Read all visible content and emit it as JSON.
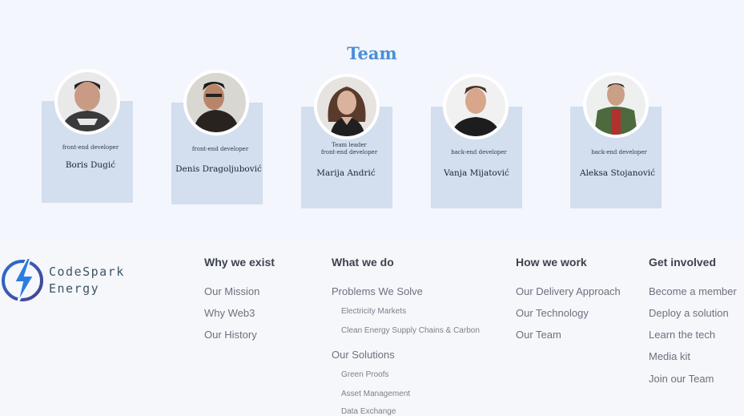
{
  "team": {
    "title": "Team",
    "members": [
      {
        "role": "front-end developer",
        "name": "Boris Dugić"
      },
      {
        "role": "front-end developer",
        "name": "Denis Dragoljubović"
      },
      {
        "role_line1": "Team leader",
        "role_line2": "front-end developer",
        "name": "Marija Andrić"
      },
      {
        "role": "back-end developer",
        "name": "Vanja Mijatović"
      },
      {
        "role": "back-end developer",
        "name": "Aleksa Stojanović"
      }
    ]
  },
  "footer": {
    "brand": {
      "line1": "CodeSpark",
      "line2": "Energy"
    },
    "columns": [
      {
        "heading": "Why we exist",
        "links": [
          "Our Mission",
          "Why Web3",
          "Our History"
        ]
      },
      {
        "heading": "What we do",
        "group1": "Problems We Solve",
        "group1_items": [
          "Electricity Markets",
          "Clean Energy Supply Chains & Carbon"
        ],
        "group2": "Our Solutions",
        "group2_items": [
          "Green Proofs",
          "Asset Management",
          "Data Exchange"
        ]
      },
      {
        "heading": "How we work",
        "links": [
          "Our Delivery Approach",
          "Our Technology",
          "Our Team"
        ]
      },
      {
        "heading": "Get involved",
        "links": [
          "Become a member",
          "Deploy a solution",
          "Learn the tech",
          "Media kit",
          "Join our Team"
        ]
      }
    ]
  },
  "colors": {
    "accent": "#4a8fd8",
    "card": "#d3deef",
    "logo_blue": "#2b6fd1",
    "logo_ring": "#4a3f8f"
  }
}
